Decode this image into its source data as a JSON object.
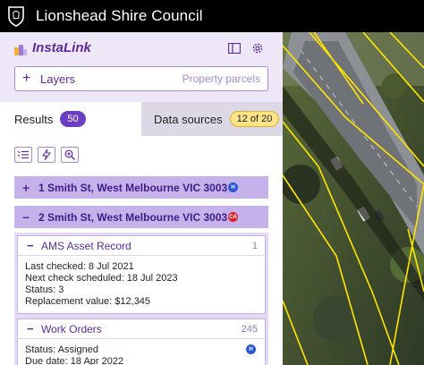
{
  "topbar": {
    "title": "Lionshead Shire Council",
    "crest_icon": "lion-crest-icon"
  },
  "app": {
    "name": "InstaLink",
    "logo_icon": "instalink-logo-icon",
    "layout_icon": "panel-layout-icon",
    "settings_icon": "gear-icon"
  },
  "layers": {
    "label": "Layers",
    "value": "Property parcels",
    "expand_icon": "plus-icon"
  },
  "tabs": {
    "results": {
      "label": "Results",
      "count": "50"
    },
    "data_sources": {
      "label": "Data sources",
      "count": "12 of 20"
    }
  },
  "toolbar": {
    "items": [
      "list-settings-icon",
      "flash-icon",
      "zoom-in-icon"
    ]
  },
  "results": [
    {
      "sign": "+",
      "address": "1 Smith St, West Melbourne VIC 3003",
      "source": "H",
      "source_color": "#2b55d6"
    },
    {
      "sign": "−",
      "address": "2 Smith St, West Melbourne VIC 3003",
      "source": "CA",
      "source_color": "#d9262a"
    }
  ],
  "cards": [
    {
      "title": "AMS Asset Record",
      "count": "1",
      "lines": [
        "Last checked: 8 Jul 2021",
        "Next check scheduled: 18 Jul 2023",
        "Status: 3",
        "Replacement value: $12,345"
      ]
    },
    {
      "title": "Work Orders",
      "count": "245",
      "lines": [
        "Status: Assigned",
        "Due date: 18 Apr 2022"
      ],
      "source": "H"
    }
  ],
  "colors": {
    "accent": "#5b2c9e",
    "result_bg": "#c5b2ea",
    "count_pill": "#6a3fc4",
    "badge_yellow": "#fde48a",
    "map_parcel_lines": "#ffe600"
  }
}
